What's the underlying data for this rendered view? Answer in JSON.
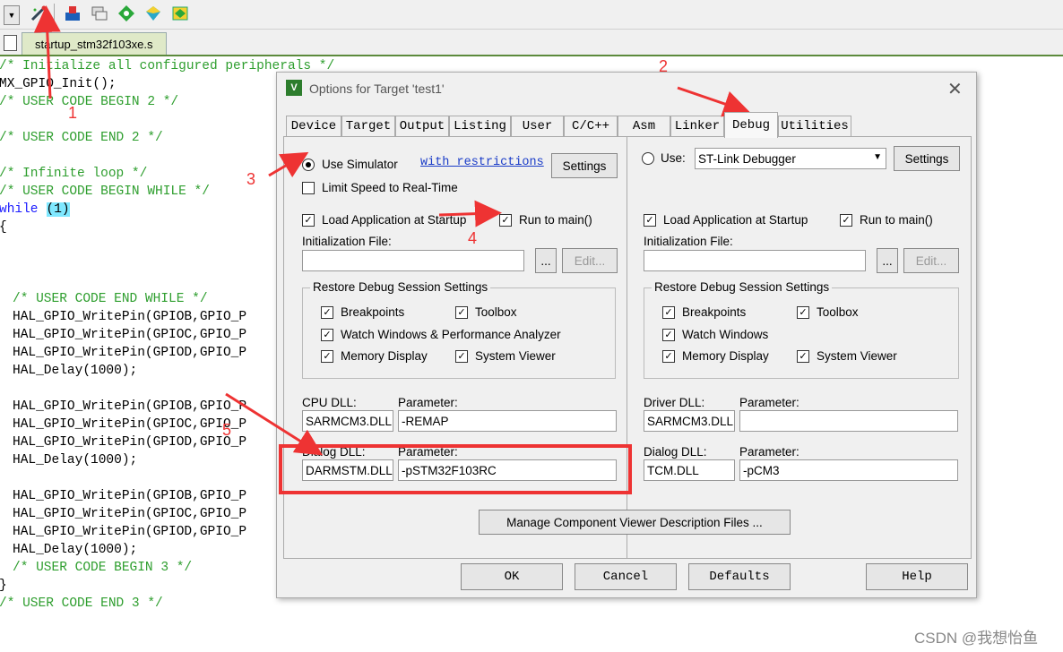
{
  "toolbar": {
    "icons": [
      "dropdown-arrow-icon",
      "wand-icon",
      "load-icon",
      "windows-icon",
      "component-icon",
      "pack-icon",
      "book-icon"
    ]
  },
  "file_tab": {
    "name": "startup_stm32f103xe.s"
  },
  "code": [
    {
      "text": "/* Initialize all configured peripherals */",
      "cls": "cm",
      "indent": 0
    },
    {
      "text": "MX_GPIO_Init();",
      "cls": "",
      "indent": 0
    },
    {
      "text": "/* USER CODE BEGIN 2 */",
      "cls": "cm",
      "indent": 0
    },
    {
      "text": "",
      "cls": "",
      "indent": 0
    },
    {
      "text": "/* USER CODE END 2 */",
      "cls": "cm",
      "indent": 0
    },
    {
      "text": "",
      "cls": "",
      "indent": 0
    },
    {
      "text": "/* Infinite loop */",
      "cls": "cm",
      "indent": 0
    },
    {
      "text": "/* USER CODE BEGIN WHILE */",
      "cls": "cm",
      "indent": 0
    },
    {
      "text": "while",
      "cls": "kw",
      "indent": 0,
      "tail": "(1)"
    },
    {
      "text": "{",
      "cls": "",
      "indent": 0
    },
    {
      "text": "",
      "cls": "",
      "indent": 0
    },
    {
      "text": "",
      "cls": "",
      "indent": 0
    },
    {
      "text": "",
      "cls": "",
      "indent": 0
    },
    {
      "text": "/* USER CODE END WHILE */",
      "cls": "cm",
      "indent": 2
    },
    {
      "text": "HAL_GPIO_WritePin(GPIOB,GPIO_P",
      "cls": "",
      "indent": 2
    },
    {
      "text": "HAL_GPIO_WritePin(GPIOC,GPIO_P",
      "cls": "",
      "indent": 2
    },
    {
      "text": "HAL_GPIO_WritePin(GPIOD,GPIO_P",
      "cls": "",
      "indent": 2
    },
    {
      "text": "HAL_Delay(1000);",
      "cls": "",
      "indent": 2
    },
    {
      "text": "",
      "cls": "",
      "indent": 0
    },
    {
      "text": "HAL_GPIO_WritePin(GPIOB,GPIO_P",
      "cls": "",
      "indent": 2
    },
    {
      "text": "HAL_GPIO_WritePin(GPIOC,GPIO_P",
      "cls": "",
      "indent": 2
    },
    {
      "text": "HAL_GPIO_WritePin(GPIOD,GPIO_P",
      "cls": "",
      "indent": 2
    },
    {
      "text": "HAL_Delay(1000);",
      "cls": "",
      "indent": 2
    },
    {
      "text": "",
      "cls": "",
      "indent": 0
    },
    {
      "text": "HAL_GPIO_WritePin(GPIOB,GPIO_P",
      "cls": "",
      "indent": 2
    },
    {
      "text": "HAL_GPIO_WritePin(GPIOC,GPIO_P",
      "cls": "",
      "indent": 2
    },
    {
      "text": "HAL_GPIO_WritePin(GPIOD,GPIO_P",
      "cls": "",
      "indent": 2
    },
    {
      "text": "HAL_Delay(1000);",
      "cls": "",
      "indent": 2
    },
    {
      "text": "/* USER CODE BEGIN 3 */",
      "cls": "cm",
      "indent": 2
    },
    {
      "text": "}",
      "cls": "",
      "indent": 0
    },
    {
      "text": "/* USER CODE END 3 */",
      "cls": "cm",
      "indent": 0
    }
  ],
  "dialog": {
    "title": "Options for Target 'test1'",
    "close": "✕",
    "tabs": [
      "Device",
      "Target",
      "Output",
      "Listing",
      "User",
      "C/C++",
      "Asm",
      "Linker",
      "Debug",
      "Utilities"
    ],
    "active_tab": "Debug",
    "left": {
      "use_simulator": "Use Simulator",
      "restrictions_link": "with restrictions",
      "settings": "Settings",
      "limit_speed": "Limit Speed to Real-Time",
      "load_app": "Load Application at Startup",
      "run_to_main": "Run to main()",
      "init_file": "Initialization File:",
      "browse": "...",
      "edit": "Edit...",
      "restore_title": "Restore Debug Session Settings",
      "breakpoints": "Breakpoints",
      "toolbox": "Toolbox",
      "watch": "Watch Windows & Performance Analyzer",
      "memory": "Memory Display",
      "sysviewer": "System Viewer",
      "cpu_dll_label": "CPU DLL:",
      "param_label": "Parameter:",
      "cpu_dll": "SARMCM3.DLL",
      "cpu_param": "-REMAP",
      "dialog_dll_label": "Dialog DLL:",
      "dialog_param_label": "Parameter:",
      "dialog_dll": "DARMSTM.DLL",
      "dialog_param": "-pSTM32F103RC"
    },
    "right": {
      "use": "Use:",
      "debugger": "ST-Link Debugger",
      "settings": "Settings",
      "load_app": "Load Application at Startup",
      "run_to_main": "Run to main()",
      "init_file": "Initialization File:",
      "browse": "...",
      "edit": "Edit...",
      "restore_title": "Restore Debug Session Settings",
      "breakpoints": "Breakpoints",
      "toolbox": "Toolbox",
      "watch": "Watch Windows",
      "memory": "Memory Display",
      "sysviewer": "System Viewer",
      "driver_dll_label": "Driver DLL:",
      "param_label": "Parameter:",
      "driver_dll": "SARMCM3.DLL",
      "driver_param": "",
      "dialog_dll_label": "Dialog DLL:",
      "dialog_param_label": "Parameter:",
      "dialog_dll": "TCM.DLL",
      "dialog_param": "-pCM3"
    },
    "manage_btn": "Manage Component Viewer Description Files ...",
    "ok": "OK",
    "cancel": "Cancel",
    "defaults": "Defaults",
    "help": "Help"
  },
  "annotations": [
    "1",
    "2",
    "3",
    "4",
    "5"
  ],
  "watermark": "CSDN @我想怡鱼",
  "colors": {
    "annotation": "#e33333",
    "comment": "#2e9e2e",
    "keyword": "#1a1aff"
  }
}
